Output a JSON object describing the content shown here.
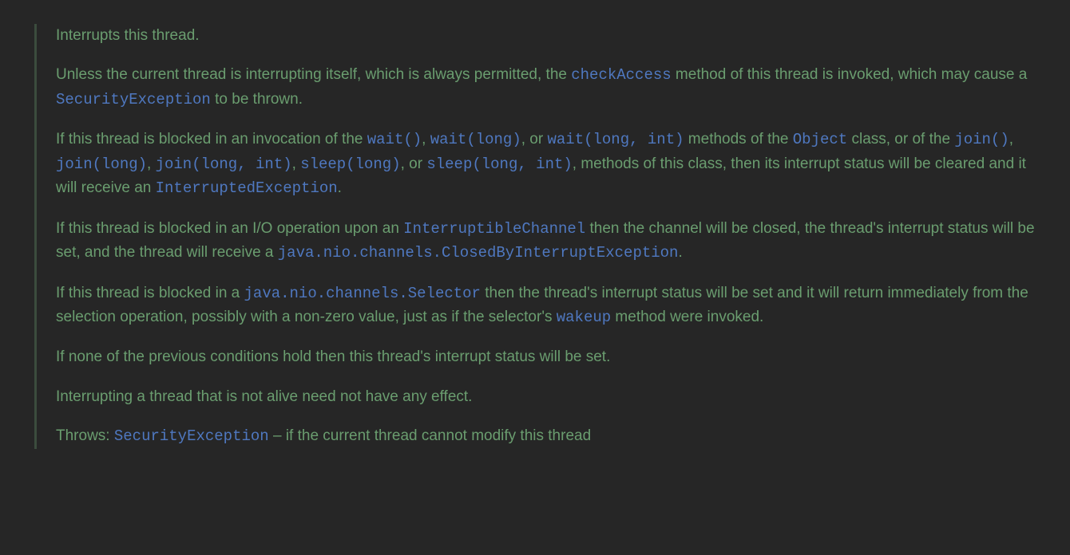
{
  "p0": {
    "t0": "Interrupts this thread."
  },
  "p1": {
    "t0": "Unless the current thread is interrupting itself, which is always permitted, the ",
    "l0": "checkAccess",
    "t1": " method of this thread is invoked, which may cause a ",
    "l1": "SecurityException",
    "t2": " to be thrown."
  },
  "p2": {
    "t0": "If this thread is blocked in an invocation of the ",
    "l0": "wait()",
    "t1": ", ",
    "l1": "wait(long)",
    "t2": ", or ",
    "l2": "wait(long, int)",
    "t3": " methods of the ",
    "l3": "Object",
    "t4": " class, or of the ",
    "l4": "join()",
    "t5": ", ",
    "l5": "join(long)",
    "t6": ", ",
    "l6": "join(long, int)",
    "t7": ", ",
    "l7": "sleep(long)",
    "t8": ", or ",
    "l8": "sleep(long, int)",
    "t9": ", methods of this class, then its interrupt status will be cleared and it will receive an ",
    "l9": "InterruptedException",
    "t10": "."
  },
  "p3": {
    "t0": "If this thread is blocked in an I/O operation upon an ",
    "l0": "InterruptibleChannel",
    "t1": " then the channel will be closed, the thread's interrupt status will be set, and the thread will receive a ",
    "l1": "java.nio.channels.ClosedByInterruptException",
    "t2": "."
  },
  "p4": {
    "t0": "If this thread is blocked in a ",
    "l0": "java.nio.channels.Selector",
    "t1": " then the thread's interrupt status will be set and it will return immediately from the selection operation, possibly with a non-zero value, just as if the selector's ",
    "l1": "wakeup",
    "t2": " method were invoked."
  },
  "p5": {
    "t0": "If none of the previous conditions hold then this thread's interrupt status will be set."
  },
  "p6": {
    "t0": "Interrupting a thread that is not alive need not have any effect."
  },
  "p7": {
    "t0": "Throws: ",
    "l0": "SecurityException",
    "t1": " – if the current thread cannot modify this thread"
  }
}
